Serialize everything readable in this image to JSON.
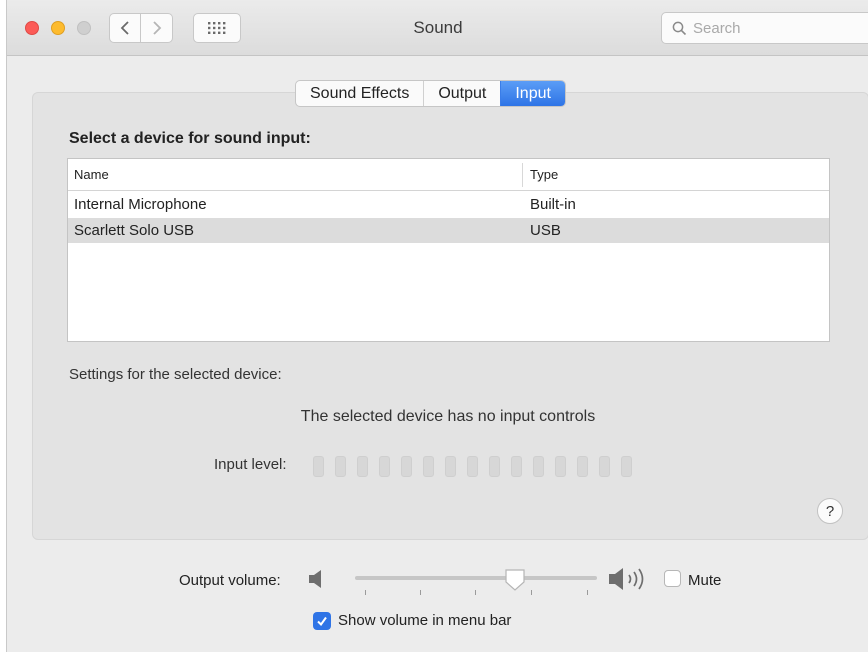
{
  "window": {
    "title": "Sound"
  },
  "search": {
    "placeholder": "Search"
  },
  "tabs": [
    {
      "label": "Sound Effects",
      "active": false
    },
    {
      "label": "Output",
      "active": false
    },
    {
      "label": "Input",
      "active": true
    }
  ],
  "input": {
    "section_title": "Select a device for sound input:",
    "columns": [
      "Name",
      "Type"
    ],
    "devices": [
      {
        "name": "Internal Microphone",
        "type": "Built-in",
        "selected": false
      },
      {
        "name": "Scarlett Solo USB",
        "type": "USB",
        "selected": true
      }
    ],
    "settings_label": "Settings for the selected device:",
    "no_controls_text": "The selected device has no input controls",
    "input_level_label": "Input level:",
    "input_level_segments": 15,
    "input_level_lit": 0
  },
  "footer": {
    "output_volume_label": "Output volume:",
    "output_volume_fraction": 0.66,
    "mute_label": "Mute",
    "mute_checked": false,
    "show_volume_label": "Show volume in menu bar",
    "show_volume_checked": true
  },
  "colors": {
    "accent": "#2f74e6",
    "close": "#fc5b57",
    "minimize": "#fdbb2e",
    "zoom_disabled": "#cfcfcf"
  },
  "icons": {
    "back": "chevron-left-icon",
    "forward": "chevron-right-icon",
    "show_all": "grid-icon",
    "search": "magnifier-icon",
    "volume_low": "speaker-low-icon",
    "volume_high": "speaker-high-icon",
    "help": "help-icon",
    "checkmark": "checkmark-icon"
  }
}
